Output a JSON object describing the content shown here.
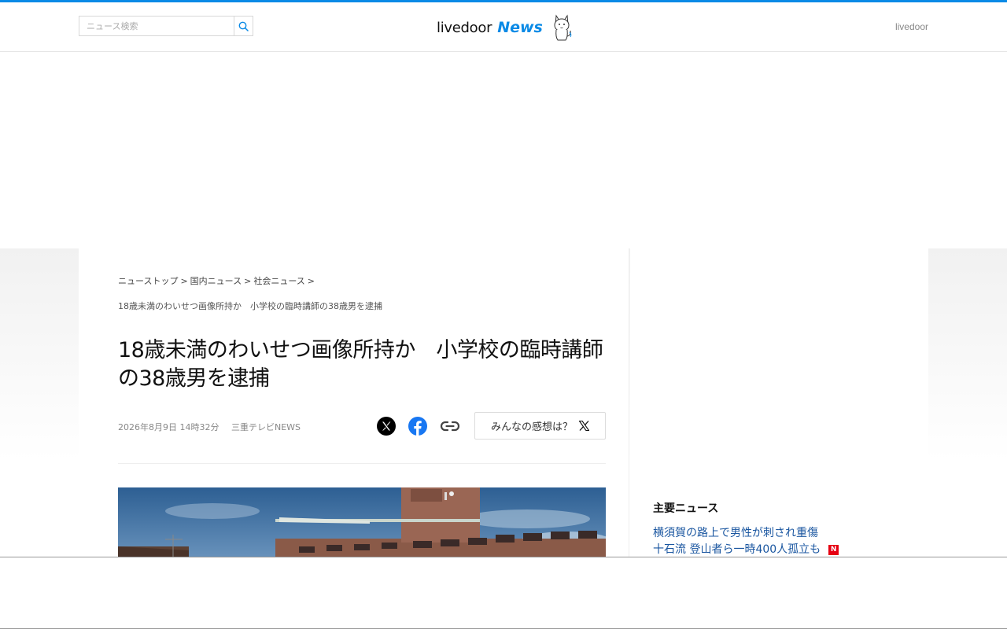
{
  "header": {
    "search_placeholder": "ニュース検索",
    "logo_main": "livedoor",
    "logo_sub": "News",
    "right_link": "livedoor"
  },
  "breadcrumb": {
    "items": [
      "ニューストップ",
      "国内ニュース",
      "社会ニュース"
    ],
    "current": "18歳未満のわいせつ画像所持か　小学校の臨時講師の38歳男を逮捕"
  },
  "article": {
    "title": "18歳未満のわいせつ画像所持か　小学校の臨時講師の38歳男を逮捕",
    "date": "2026年8月9日 14時32分",
    "source": "三重テレビNEWS",
    "reaction_label": "みんなの感想は？"
  },
  "sidebar": {
    "section_title": "主要ニュース",
    "news": [
      {
        "text": "横須賀の路上で男性が刺され重傷",
        "badge": ""
      },
      {
        "text": "十石流 登山者ら一時400人孤立も",
        "badge": "N"
      }
    ]
  },
  "colors": {
    "accent": "#0a8ae6",
    "link": "#1a56a0",
    "badge": "#e60012"
  },
  "icons": [
    "search-icon",
    "mascot-icon",
    "x-icon",
    "facebook-icon",
    "link-icon"
  ]
}
